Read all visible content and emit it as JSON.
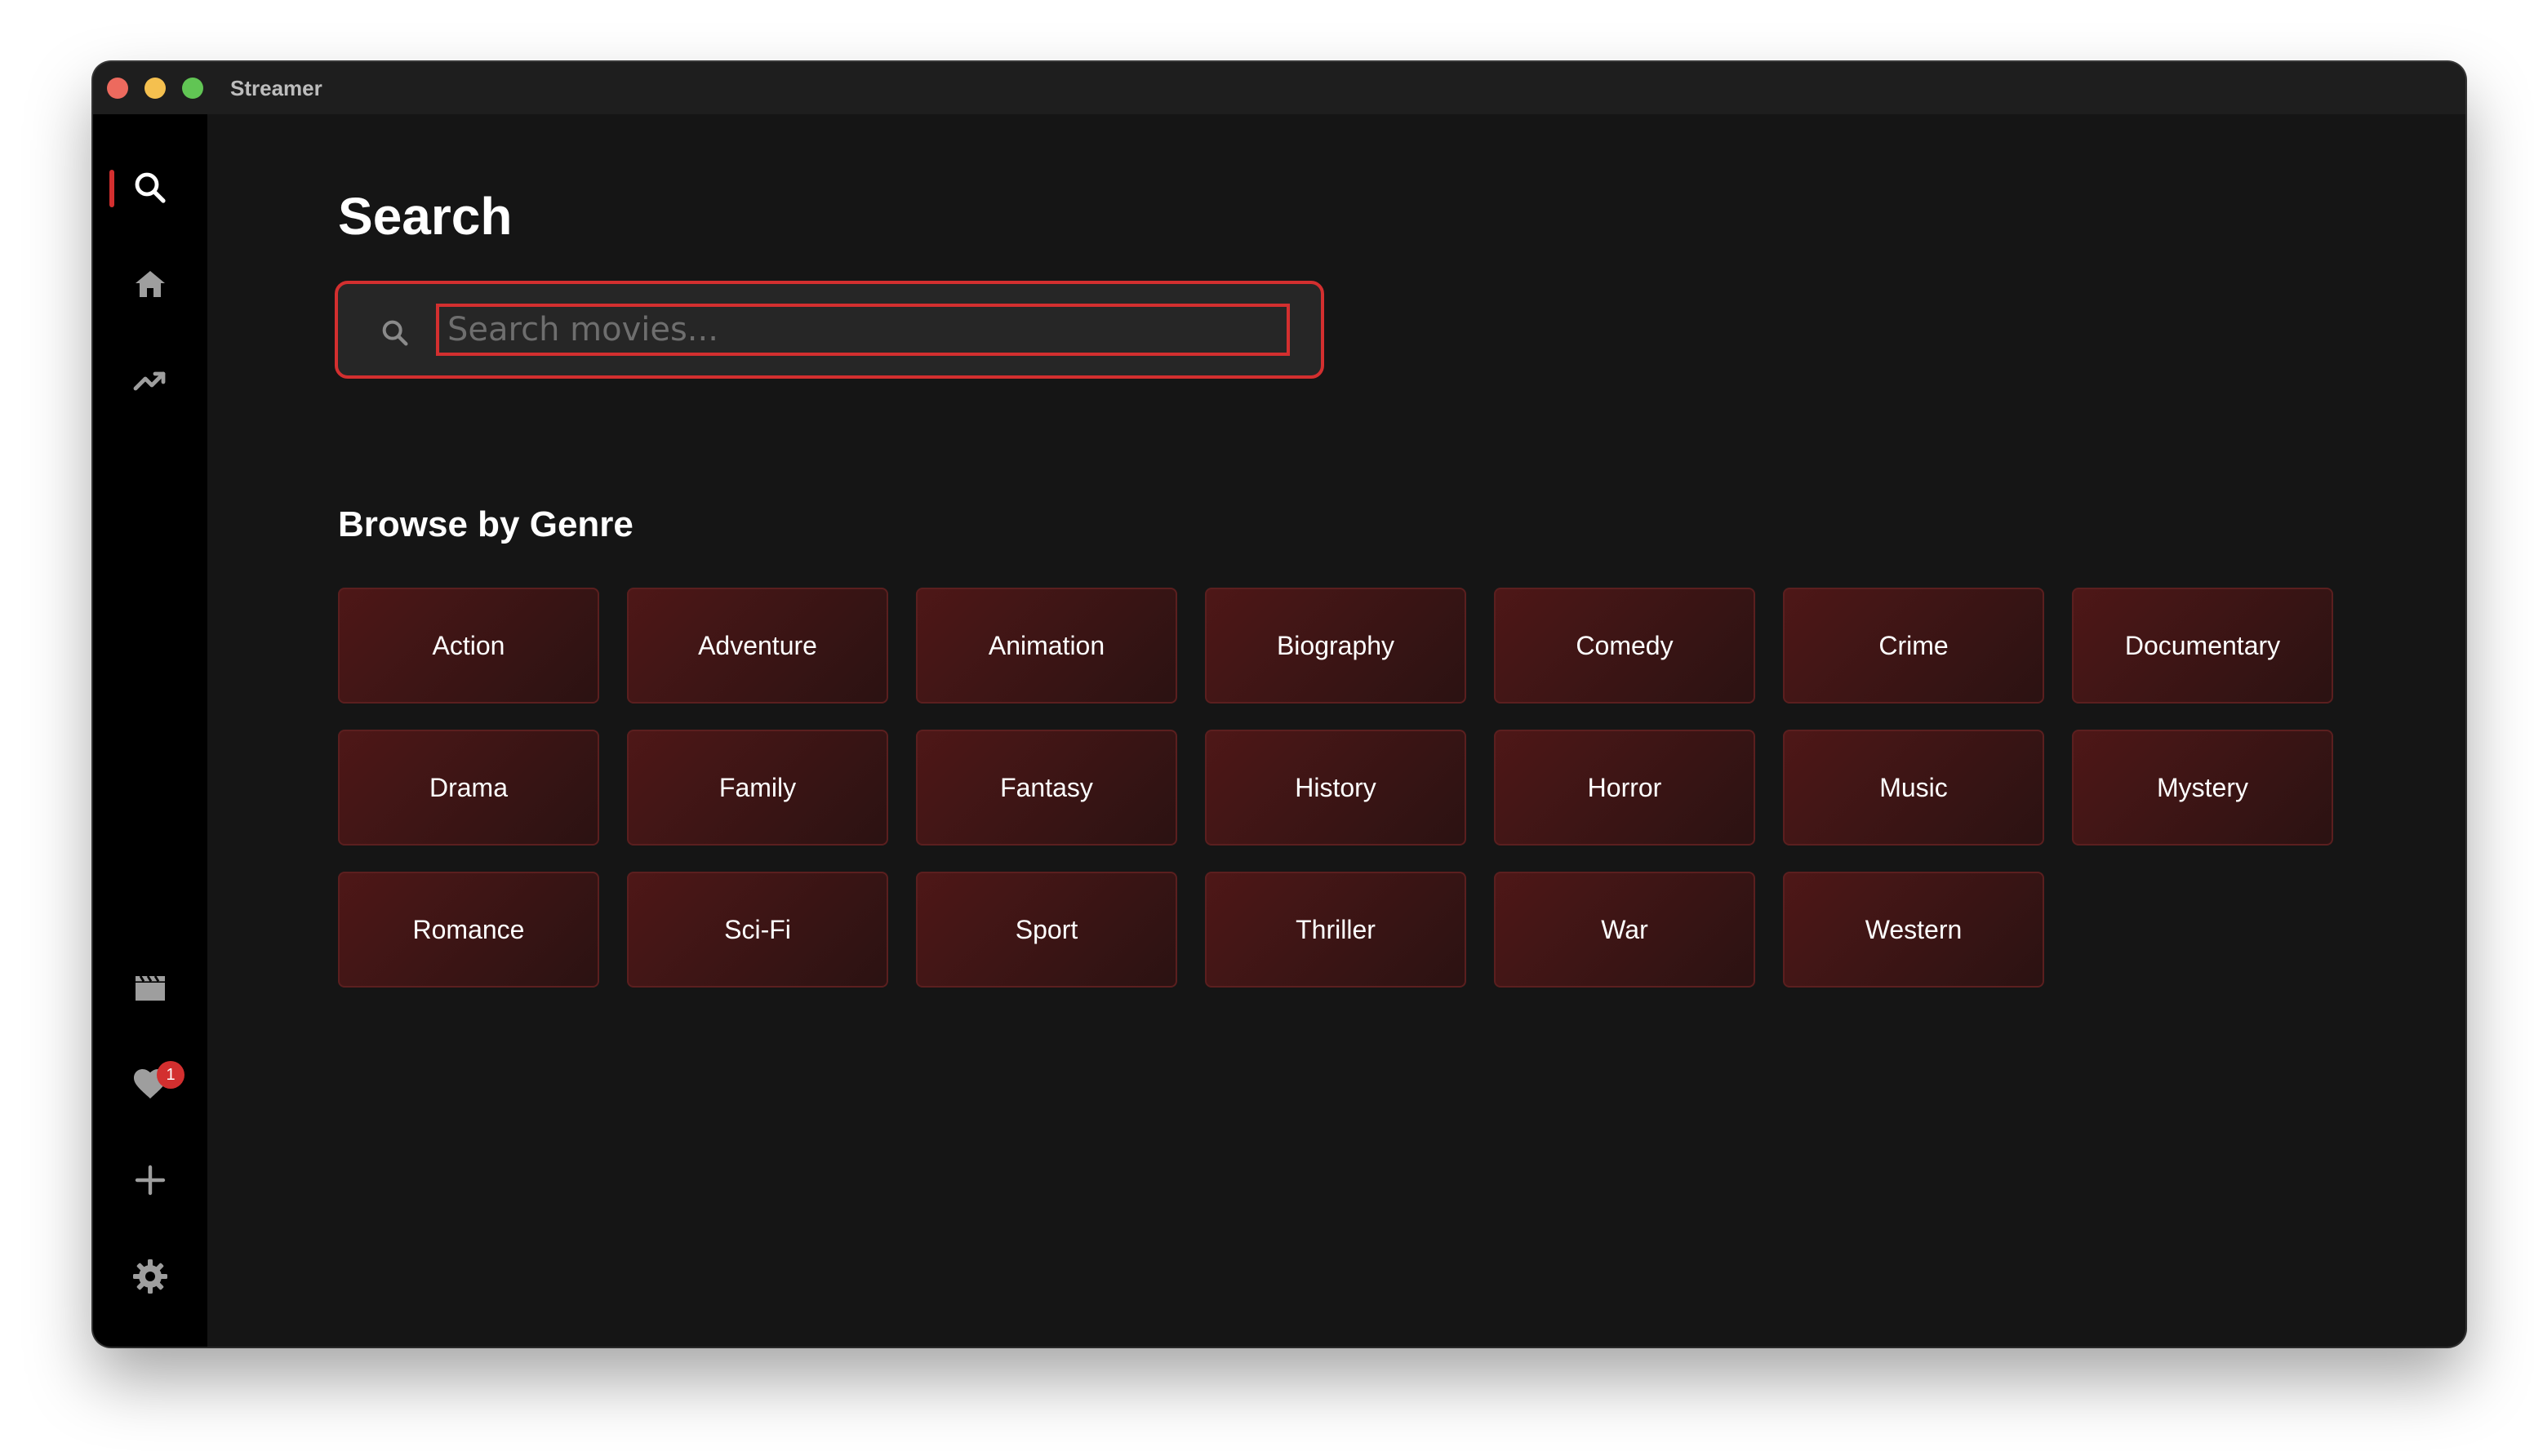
{
  "window": {
    "title": "Streamer"
  },
  "sidebar": {
    "top_items": [
      {
        "name": "search",
        "icon": "search-icon",
        "active": true
      },
      {
        "name": "home",
        "icon": "home-icon",
        "active": false
      },
      {
        "name": "trending",
        "icon": "trending-up-icon",
        "active": false
      }
    ],
    "bottom_items": [
      {
        "name": "movies",
        "icon": "clapperboard-icon"
      },
      {
        "name": "favorites",
        "icon": "heart-icon",
        "badge": "1"
      },
      {
        "name": "add",
        "icon": "plus-icon"
      },
      {
        "name": "settings",
        "icon": "gear-icon"
      }
    ],
    "favorites_badge": "1"
  },
  "main": {
    "title": "Search",
    "search": {
      "placeholder": "Search movies...",
      "value": ""
    },
    "genre_section_title": "Browse by Genre",
    "genres": [
      "Action",
      "Adventure",
      "Animation",
      "Biography",
      "Comedy",
      "Crime",
      "Documentary",
      "Drama",
      "Family",
      "Fantasy",
      "History",
      "Horror",
      "Music",
      "Mystery",
      "Romance",
      "Sci-Fi",
      "Sport",
      "Thriller",
      "War",
      "Western"
    ]
  },
  "colors": {
    "accent": "#d32f2f",
    "background": "#151515",
    "sidebar": "#000000",
    "genre_tile": "#4e1717",
    "icon": "#9e9e9e"
  }
}
